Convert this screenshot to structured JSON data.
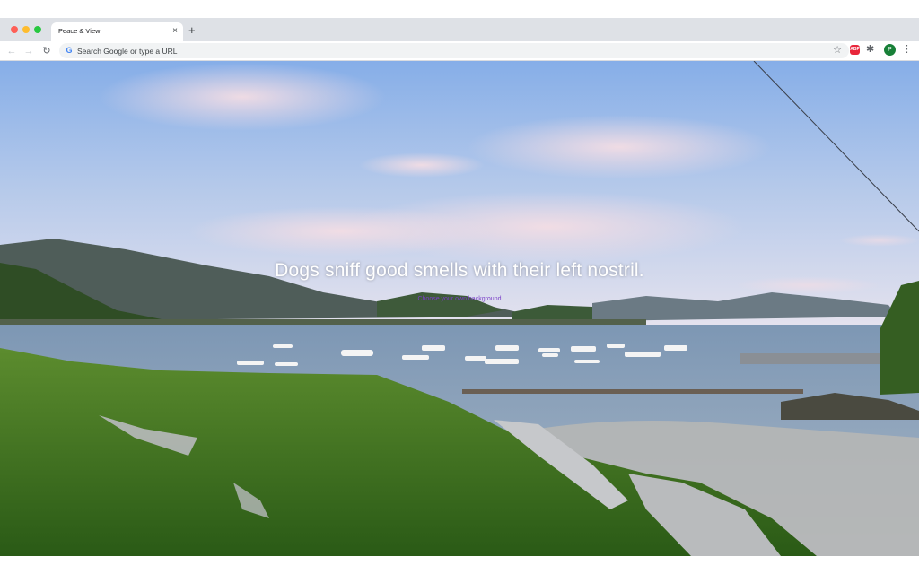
{
  "browser": {
    "tab": {
      "title": "Peace & View",
      "close_glyph": "×"
    },
    "new_tab_glyph": "+",
    "toolbar": {
      "back_glyph": "←",
      "forward_glyph": "→",
      "reload_glyph": "↻",
      "omnibox": {
        "placeholder": "Search Google or type a URL",
        "value": "",
        "search_engine_icon": "G"
      },
      "star_glyph": "☆",
      "adblock_label": "ABP",
      "extensions_glyph": "✱",
      "profile_initial": "P",
      "menu_glyph": "⋮"
    },
    "icons": {
      "back": "arrow-left-icon",
      "forward": "arrow-right-icon",
      "reload": "reload-icon",
      "search_engine": "google-icon",
      "bookmark": "star-icon",
      "adblock": "adblock-icon",
      "extensions": "puzzle-icon",
      "menu": "kebab-menu-icon"
    },
    "colors": {
      "tabstrip": "#dee1e6",
      "omnibox": "#f1f3f4",
      "close": "#fe5f57",
      "minimize": "#febc2e",
      "maximize": "#28c840",
      "adblock": "#e8263b",
      "profile": "#188038"
    }
  },
  "page": {
    "quote": "Dogs sniff good smells with their left nostril.",
    "choose_link": "Choose your own background",
    "quote_color": "#ffffff",
    "link_color": "#7a3fc8"
  }
}
